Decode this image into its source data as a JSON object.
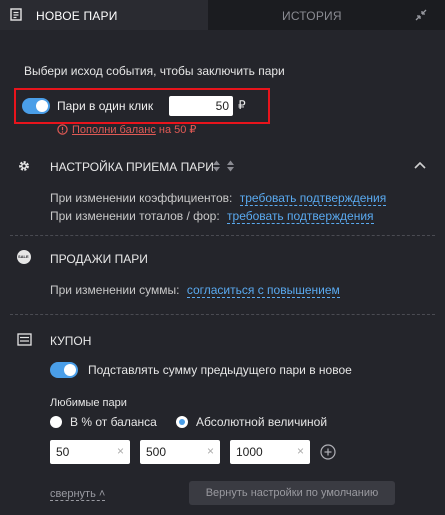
{
  "tabs": [
    {
      "label": "НОВОЕ ПАРИ"
    },
    {
      "label": "ИСТОРИЯ"
    }
  ],
  "intro": "Выбери исход события, чтобы заключить пари",
  "one_click": {
    "label": "Пари в один клик",
    "amount": "50",
    "currency": "₽",
    "warning_link": "Пополни баланс",
    "warning_rest": "на 50 ₽"
  },
  "settings": {
    "title": "НАСТРОЙКА ПРИЕМА ПАРИ",
    "row1_label": "При изменении коэффициентов:",
    "row1_value": "требовать подтверждения",
    "row2_label": "При изменении тоталов / фор:",
    "row2_value": "требовать подтверждения"
  },
  "sales": {
    "title": "ПРОДАЖИ ПАРИ",
    "icon_text": "SALE",
    "row_label": "При изменении суммы:",
    "row_value": "согласиться с повышением"
  },
  "coupon": {
    "title": "КУПОН",
    "toggle_label": "Подставлять сумму предыдущего пари в новое",
    "favorites_title": "Любимые пари",
    "radio1": "В % от баланса",
    "radio2": "Абсолютной величиной",
    "amounts": [
      "50",
      "500",
      "1000"
    ],
    "collapse": "свернуть",
    "reset": "Вернуть настройки по умолчанию"
  },
  "colors": {
    "accent": "#4a9ee8",
    "link": "#5aaaf0",
    "warning": "#e05a55",
    "highlight_border": "#e8141c"
  }
}
